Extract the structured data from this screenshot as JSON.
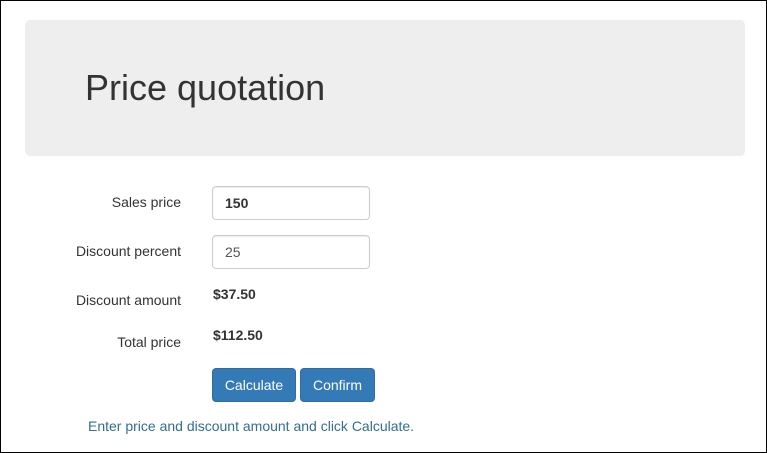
{
  "header": {
    "title": "Price quotation"
  },
  "form": {
    "sales_price": {
      "label": "Sales price",
      "value": "150"
    },
    "discount_percent": {
      "label": "Discount percent",
      "value": "25"
    },
    "discount_amount": {
      "label": "Discount amount",
      "value": "$37.50"
    },
    "total_price": {
      "label": "Total price",
      "value": "$112.50"
    }
  },
  "buttons": {
    "calculate_label": "Calculate",
    "confirm_label": "Confirm"
  },
  "message": "Enter price and discount amount and click Calculate.",
  "colors": {
    "primary_button": "#337ab7",
    "jumbotron_bg": "#eeeeee",
    "info_text": "#31708f"
  }
}
